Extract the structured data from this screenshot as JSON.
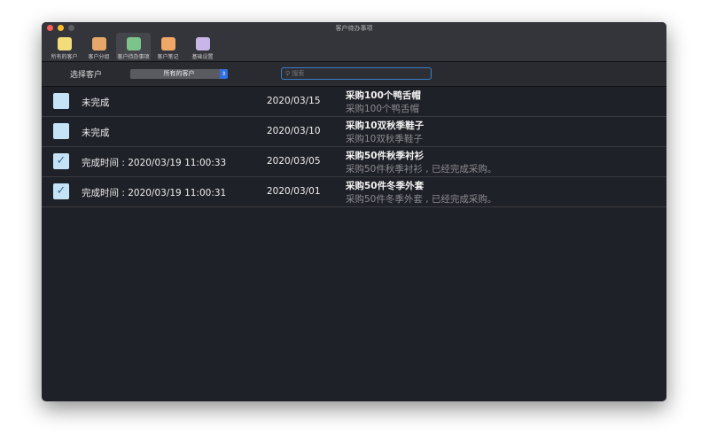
{
  "window": {
    "title": "客户待办事项"
  },
  "toolbar": [
    {
      "label": "所有的客户",
      "icon": "person-icon",
      "color": "#f3dc7a"
    },
    {
      "label": "客户分组",
      "icon": "group-icon",
      "color": "#e6a86a"
    },
    {
      "label": "客户待办事项",
      "icon": "todo-box-icon",
      "color": "#7cc48a",
      "active": true
    },
    {
      "label": "客户笔记",
      "icon": "note-icon",
      "color": "#f0a868"
    },
    {
      "label": "基础设置",
      "icon": "gear-icon",
      "color": "#c9b6e8"
    }
  ],
  "filter": {
    "label": "选择客户",
    "select_value": "所有的客户",
    "search_placeholder": "搜索"
  },
  "rows": [
    {
      "checked": false,
      "status": "未完成",
      "date": "2020/03/15",
      "title": "采购100个鸭舌帽",
      "detail": "采购100个鸭舌帽"
    },
    {
      "checked": false,
      "status": "未完成",
      "date": "2020/03/10",
      "title": "采购10双秋季鞋子",
      "detail": "采购10双秋季鞋子"
    },
    {
      "checked": true,
      "status": "完成时间 : 2020/03/19 11:00:33",
      "date": "2020/03/05",
      "title": "采购50件秋季衬衫",
      "detail": "采购50件秋季衬衫 , 已经完成采购。"
    },
    {
      "checked": true,
      "status": "完成时间 : 2020/03/19 11:00:31",
      "date": "2020/03/01",
      "title": "采购50件冬季外套",
      "detail": "采购50件冬季外套 , 已经完成采购。"
    }
  ]
}
